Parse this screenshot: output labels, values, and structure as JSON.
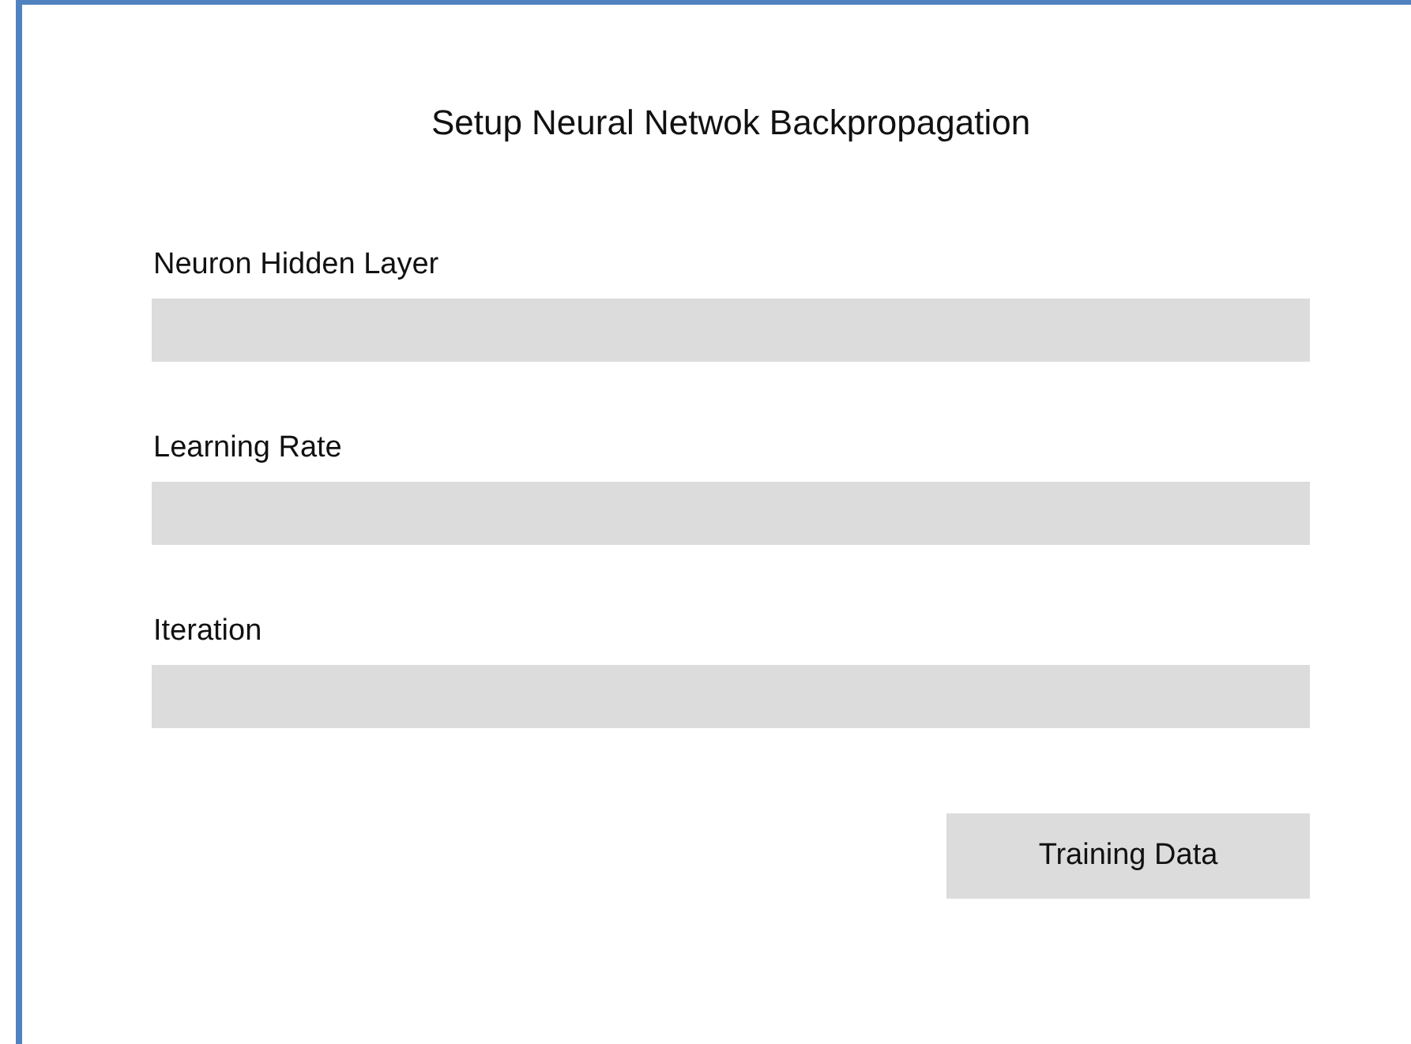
{
  "title": "Setup Neural Netwok Backpropagation",
  "fields": [
    {
      "label": "Neuron Hidden Layer"
    },
    {
      "label": "Learning Rate"
    },
    {
      "label": "Iteration"
    }
  ],
  "buttons": [
    {
      "label": "Training Data"
    }
  ]
}
